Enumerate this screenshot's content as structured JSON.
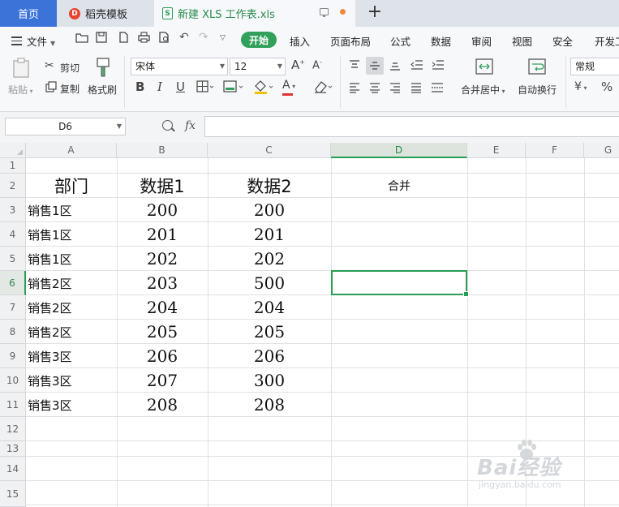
{
  "tabs": {
    "home": "首页",
    "template": "稻壳模板",
    "file": "新建 XLS 工作表.xls",
    "new_tab": "+"
  },
  "menu": {
    "file": "文件",
    "items": [
      "开始",
      "插入",
      "页面布局",
      "公式",
      "数据",
      "审阅",
      "视图",
      "安全",
      "开发工"
    ]
  },
  "ribbon": {
    "paste": "粘贴",
    "cut": "剪切",
    "copy": "复制",
    "format_painter": "格式刷",
    "font_name": "宋体",
    "font_size": "12",
    "bold": "B",
    "italic": "I",
    "underline": "U",
    "merge_center": "合并居中",
    "wrap_text": "自动换行",
    "number_format": "常规",
    "percent": "%"
  },
  "formula_bar": {
    "name_box": "D6",
    "fx": "fx",
    "formula": ""
  },
  "grid": {
    "columns": [
      "A",
      "B",
      "C",
      "D",
      "E",
      "F",
      "G"
    ],
    "selected_column": "D",
    "rows": [
      "1",
      "2",
      "3",
      "4",
      "5",
      "6",
      "7",
      "8",
      "9",
      "10",
      "11",
      "12",
      "13",
      "14",
      "15"
    ],
    "selected_row": "6",
    "header_row": {
      "a": "部门",
      "b": "数据1",
      "c": "数据2",
      "d": "合并"
    },
    "data_rows": [
      {
        "a": "销售1区",
        "b": "200",
        "c": "200"
      },
      {
        "a": "销售1区",
        "b": "201",
        "c": "201"
      },
      {
        "a": "销售1区",
        "b": "202",
        "c": "202"
      },
      {
        "a": "销售2区",
        "b": "203",
        "c": "500"
      },
      {
        "a": "销售2区",
        "b": "204",
        "c": "204"
      },
      {
        "a": "销售2区",
        "b": "205",
        "c": "205"
      },
      {
        "a": "销售3区",
        "b": "206",
        "c": "206"
      },
      {
        "a": "销售3区",
        "b": "207",
        "c": "300"
      },
      {
        "a": "销售3区",
        "b": "208",
        "c": "208"
      }
    ]
  },
  "watermark": {
    "line1": "Bai经验",
    "line2": "jingyan.baidu.com"
  },
  "colors": {
    "accent_green": "#2a9d55",
    "home_tab_blue": "#3b73d9"
  }
}
